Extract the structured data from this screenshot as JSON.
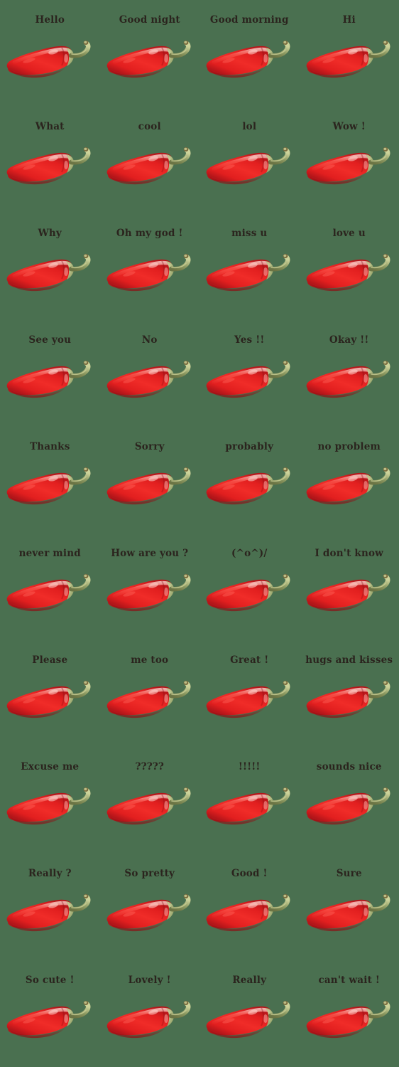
{
  "sheet": {
    "background_color": "#4a7050",
    "columns": 4,
    "rows": 10,
    "total_stickers": 40,
    "sticker_icon_name": "red-chili-pepper",
    "caption_color": "#2b241e",
    "pepper_colors": {
      "body_bright": "#f02c28",
      "body_mid": "#e21f1f",
      "body_shadow": "#b4161a",
      "body_deep_shadow": "#8d1014",
      "highlight": "#ff6b60",
      "specular": "#ffd9d2",
      "stem_green": "#8d9a62",
      "stem_light": "#cdd39a",
      "stem_dark": "#6b7444",
      "stem_tip": "#7a6a3c"
    }
  },
  "stickers": [
    {
      "caption": "Hello"
    },
    {
      "caption": "Good night"
    },
    {
      "caption": "Good morning"
    },
    {
      "caption": "Hi"
    },
    {
      "caption": "What"
    },
    {
      "caption": "cool"
    },
    {
      "caption": "lol"
    },
    {
      "caption": "Wow !"
    },
    {
      "caption": "Why"
    },
    {
      "caption": "Oh my god !"
    },
    {
      "caption": "miss u"
    },
    {
      "caption": "love u"
    },
    {
      "caption": "See you"
    },
    {
      "caption": "No"
    },
    {
      "caption": "Yes !!"
    },
    {
      "caption": "Okay !!"
    },
    {
      "caption": "Thanks"
    },
    {
      "caption": "Sorry"
    },
    {
      "caption": "probably"
    },
    {
      "caption": "no problem"
    },
    {
      "caption": "never mind"
    },
    {
      "caption": "How are you ?"
    },
    {
      "caption": "(^o^)/"
    },
    {
      "caption": "I don't know"
    },
    {
      "caption": "Please"
    },
    {
      "caption": "me too"
    },
    {
      "caption": "Great !"
    },
    {
      "caption": "hugs and kisses"
    },
    {
      "caption": "Excuse me"
    },
    {
      "caption": "?????"
    },
    {
      "caption": "!!!!!"
    },
    {
      "caption": "sounds  nice"
    },
    {
      "caption": "Really ?"
    },
    {
      "caption": "So pretty"
    },
    {
      "caption": "Good !"
    },
    {
      "caption": "Sure"
    },
    {
      "caption": "So cute !"
    },
    {
      "caption": "Lovely !"
    },
    {
      "caption": "Really"
    },
    {
      "caption": "can't wait !"
    }
  ]
}
